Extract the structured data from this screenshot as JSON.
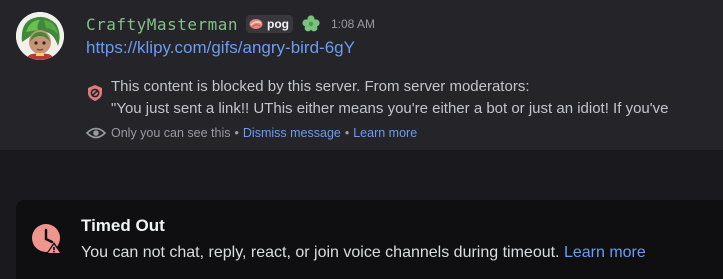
{
  "message": {
    "author": "CraftyMasterman",
    "tag_label": "pog",
    "timestamp": "1:08 AM",
    "link_text": "https://klipy.com/gifs/angry-bird-6gY",
    "blocked_notice": "This content is blocked by this server. From server moderators:",
    "moderator_reason": "\"You just sent a link!! UThis either means you're either a bot or just an idiot! If you've",
    "ephemeral_note": "Only you can see this",
    "ephemeral_separator": "•",
    "dismiss_label": "Dismiss message",
    "learn_more_label": "Learn more"
  },
  "timeout": {
    "title": "Timed Out",
    "description": "You can not chat, reply, react, or join voice channels during timeout.",
    "learn_more_label": "Learn more"
  },
  "colors": {
    "username": "#84c08a",
    "link": "#6b9cf0",
    "message_bg": "#242429",
    "page_bg": "#1a1a1e",
    "timeout_bg": "#0f0f12",
    "timeout_icon": "#f0958d"
  },
  "icons": {
    "tag": "pog-food-icon",
    "role": "flower-icon",
    "blocked": "shield-block-icon",
    "ephemeral": "eye-icon",
    "timeout": "clock-warning-icon"
  }
}
